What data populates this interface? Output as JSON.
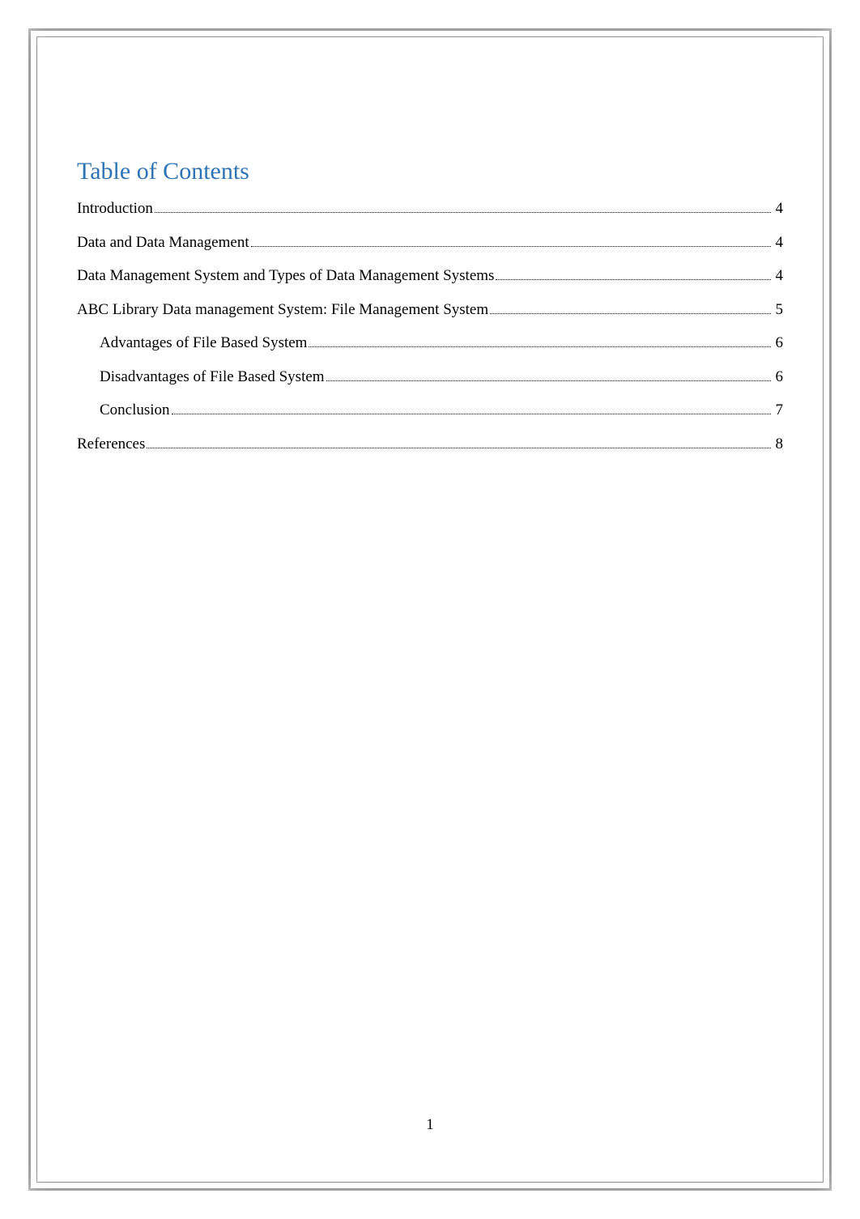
{
  "title": "Table of Contents",
  "pageNumber": "1",
  "toc": {
    "items": [
      {
        "label": "Introduction",
        "page": "4",
        "indent": false
      },
      {
        "label": "Data and Data Management",
        "page": "4",
        "indent": false
      },
      {
        "label": "Data Management System and Types of Data Management Systems",
        "page": "4",
        "indent": false
      },
      {
        "label": "ABC Library Data management System: File Management System",
        "page": "5",
        "indent": false
      },
      {
        "label": "Advantages of File Based System",
        "page": "6",
        "indent": true
      },
      {
        "label": "Disadvantages of File Based System",
        "page": "6",
        "indent": true
      },
      {
        "label": "Conclusion",
        "page": "7",
        "indent": true
      },
      {
        "label": "References",
        "page": "8",
        "indent": false
      }
    ]
  }
}
